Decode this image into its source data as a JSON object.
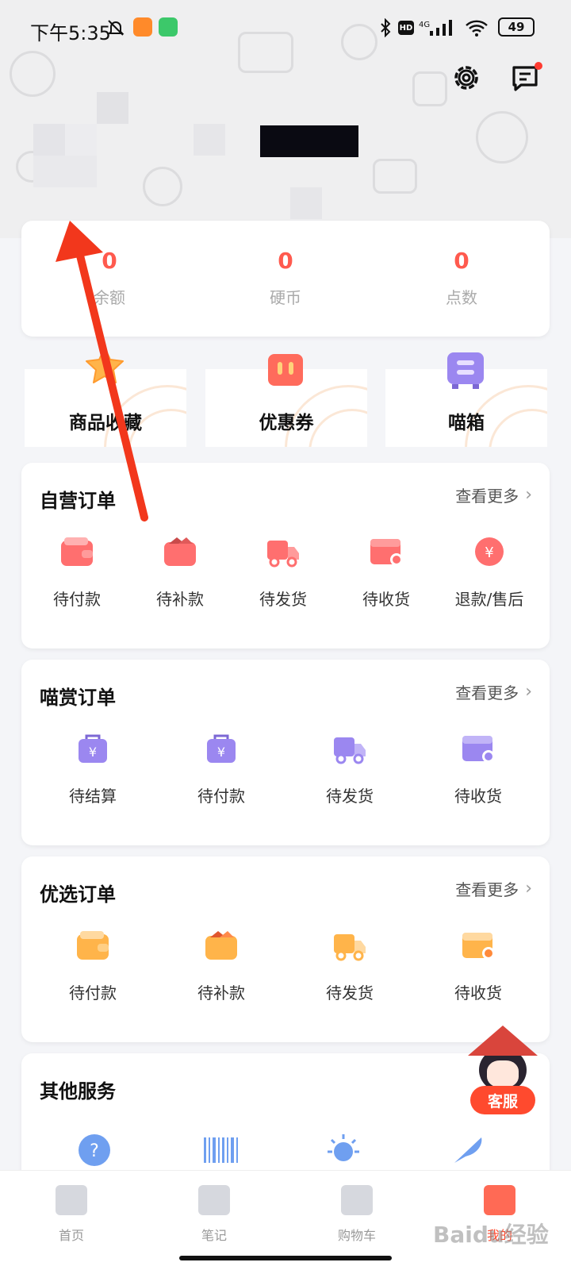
{
  "status_bar": {
    "time": "下午5:35",
    "battery": "49",
    "network": "4G",
    "hd": "HD"
  },
  "header": {
    "settings_icon": "gear-icon",
    "message_icon": "message-icon",
    "has_unread": true
  },
  "assets": [
    {
      "value": "0",
      "label": "余额"
    },
    {
      "value": "0",
      "label": "硬币"
    },
    {
      "value": "0",
      "label": "点数"
    }
  ],
  "quick_tiles": [
    {
      "label": "商品收藏",
      "icon": "star-icon",
      "color": "#ffb44a"
    },
    {
      "label": "优惠券",
      "icon": "coupon-icon",
      "color": "#ff6b5c"
    },
    {
      "label": "喵箱",
      "icon": "box-icon",
      "color": "#9b87f0"
    }
  ],
  "sections": {
    "self_orders": {
      "title": "自营订单",
      "more": "查看更多",
      "items": [
        {
          "label": "待付款",
          "icon": "wallet-icon",
          "color": "#ff6f6f"
        },
        {
          "label": "待补款",
          "icon": "wallet-icon",
          "color": "#ff6f6f"
        },
        {
          "label": "待发货",
          "icon": "truck-icon",
          "color": "#ff6f6f"
        },
        {
          "label": "待收货",
          "icon": "package-icon",
          "color": "#ff6f6f"
        },
        {
          "label": "退款/售后",
          "icon": "refund-icon",
          "color": "#ff6f6f"
        }
      ]
    },
    "miao_orders": {
      "title": "喵赏订单",
      "more": "查看更多",
      "items": [
        {
          "label": "待结算",
          "icon": "bag-yen-icon",
          "color": "#9b87f0"
        },
        {
          "label": "待付款",
          "icon": "bag-yen-icon",
          "color": "#9b87f0"
        },
        {
          "label": "待发货",
          "icon": "truck-icon",
          "color": "#9b87f0"
        },
        {
          "label": "待收货",
          "icon": "package-icon",
          "color": "#9b87f0"
        }
      ]
    },
    "select_orders": {
      "title": "优选订单",
      "more": "查看更多",
      "items": [
        {
          "label": "待付款",
          "icon": "wallet-icon",
          "color": "#ffb44a"
        },
        {
          "label": "待补款",
          "icon": "wallet-icon",
          "color": "#ffb44a"
        },
        {
          "label": "待发货",
          "icon": "truck-icon",
          "color": "#ffb44a"
        },
        {
          "label": "待收货",
          "icon": "package-icon",
          "color": "#ffb44a"
        }
      ]
    },
    "other_services": {
      "title": "其他服务"
    }
  },
  "customer_service": {
    "label": "客服"
  },
  "bottom_nav": [
    {
      "label": "首页",
      "icon": "home-icon",
      "active": false
    },
    {
      "label": "笔记",
      "icon": "notes-icon",
      "active": false
    },
    {
      "label": "购物车",
      "icon": "cart-icon",
      "active": false
    },
    {
      "label": "我的",
      "icon": "profile-icon",
      "active": true
    }
  ],
  "watermark": "Baidu经验"
}
